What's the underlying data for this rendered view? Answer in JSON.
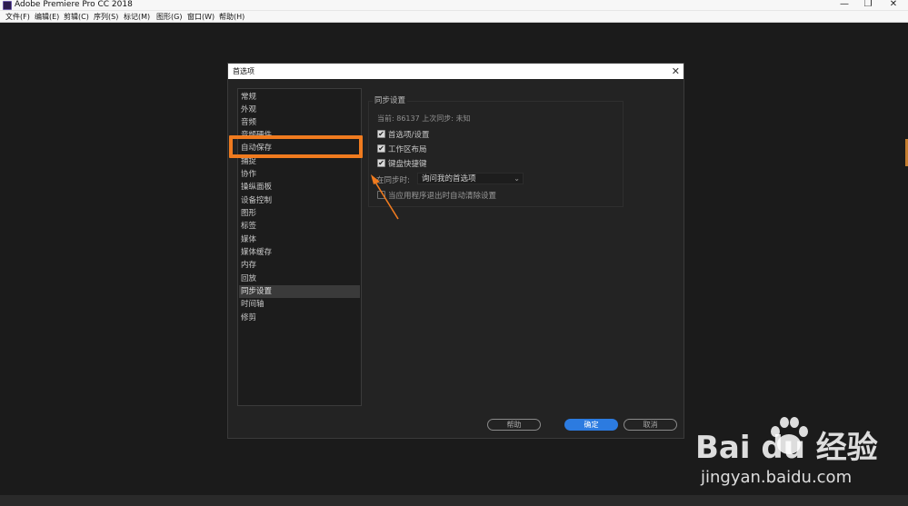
{
  "window": {
    "title": "Adobe Premiere Pro CC 2018",
    "controls": [
      "—",
      "❐",
      "✕"
    ]
  },
  "menubar": {
    "items": [
      "文件(F)",
      "编辑(E)",
      "剪辑(C)",
      "序列(S)",
      "标记(M)",
      "图形(G)",
      "窗口(W)",
      "帮助(H)"
    ]
  },
  "dialog": {
    "title": "首选项",
    "close": "✕",
    "categories": [
      {
        "label": "常规",
        "selected": false
      },
      {
        "label": "外观",
        "selected": false
      },
      {
        "label": "音频",
        "selected": false
      },
      {
        "label": "音频硬件",
        "selected": false
      },
      {
        "label": "自动保存",
        "selected": false
      },
      {
        "label": "捕捉",
        "selected": false
      },
      {
        "label": "协作",
        "selected": false
      },
      {
        "label": "操纵面板",
        "selected": false
      },
      {
        "label": "设备控制",
        "selected": false
      },
      {
        "label": "图形",
        "selected": false
      },
      {
        "label": "标签",
        "selected": false
      },
      {
        "label": "媒体",
        "selected": false
      },
      {
        "label": "媒体缓存",
        "selected": false
      },
      {
        "label": "内存",
        "selected": false
      },
      {
        "label": "回放",
        "selected": false
      },
      {
        "label": "同步设置",
        "selected": true
      },
      {
        "label": "时间轴",
        "selected": false
      },
      {
        "label": "修剪",
        "selected": false
      }
    ],
    "highlight_label": "自动保存",
    "sync": {
      "group_title": "同步设置",
      "status": "当前: 86137   上次同步: 未知",
      "options": [
        {
          "label": "首选项/设置",
          "checked": true
        },
        {
          "label": "工作区布局",
          "checked": true
        },
        {
          "label": "键盘快捷键",
          "checked": true
        }
      ],
      "on_sync_label": "在同步时:",
      "on_sync_value": "询问我的首选项",
      "clear_on_exit": {
        "label": "当应用程序退出时自动清除设置",
        "checked": false
      }
    },
    "buttons": {
      "help": "帮助",
      "ok": "确定",
      "cancel": "取消"
    }
  },
  "watermark": {
    "brand": "Bai  du 经验",
    "url": "jingyan.baidu.com"
  },
  "colors": {
    "highlight": "#f07b1f",
    "accent_button": "#2c7be0",
    "dialog_bg": "#232323"
  }
}
